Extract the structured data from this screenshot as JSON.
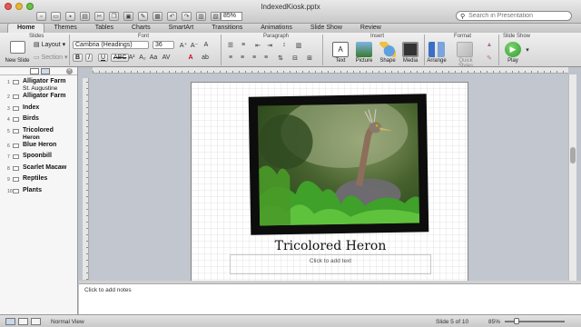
{
  "window": {
    "title": "IndexedKiosk.pptx",
    "zoom_value": "85%"
  },
  "search": {
    "placeholder": "Search in Presentation"
  },
  "tabs": [
    "Home",
    "Themes",
    "Tables",
    "Charts",
    "SmartArt",
    "Transitions",
    "Animations",
    "Slide Show",
    "Review"
  ],
  "ribbon": {
    "groups": {
      "slides": "Slides",
      "font": "Font",
      "paragraph": "Paragraph",
      "insert": "Insert",
      "format": "Format",
      "slideshow": "Slide Show"
    },
    "new_slide": "New Slide",
    "layout": "Layout",
    "section": "Section",
    "font_name": "Cambria (Headings)",
    "font_size": "36",
    "bold": "B",
    "italic": "I",
    "underline": "U",
    "strike": "ABC",
    "text": "Text",
    "picture": "Picture",
    "shape": "Shape",
    "media": "Media",
    "arrange": "Arrange",
    "quick_styles": "Quick Styles",
    "play": "Play"
  },
  "outline": [
    {
      "num": "1",
      "title": "Alligator Farm",
      "sub": "St. Augustine"
    },
    {
      "num": "2",
      "title": "Alligator Farm",
      "sub": ""
    },
    {
      "num": "3",
      "title": "Index",
      "sub": ""
    },
    {
      "num": "4",
      "title": "Birds",
      "sub": ""
    },
    {
      "num": "5",
      "title": "Tricolored",
      "sub": "Heron"
    },
    {
      "num": "6",
      "title": "Blue Heron",
      "sub": ""
    },
    {
      "num": "7",
      "title": "Spoonbill",
      "sub": ""
    },
    {
      "num": "8",
      "title": "Scarlet Macaw",
      "sub": ""
    },
    {
      "num": "9",
      "title": "Reptiles",
      "sub": ""
    },
    {
      "num": "10",
      "title": "Plants",
      "sub": ""
    }
  ],
  "slide": {
    "title": "Tricolored Heron",
    "placeholder": "Click to add text"
  },
  "notes": {
    "placeholder": "Click to add notes"
  },
  "status": {
    "mode": "Normal View",
    "position": "Slide 5 of 10",
    "zoom": "85%"
  },
  "colors": {
    "play_green": "#2e9e2e",
    "ribbon_accent": "#3a6fc4",
    "font_color_red": "#d0021b"
  }
}
